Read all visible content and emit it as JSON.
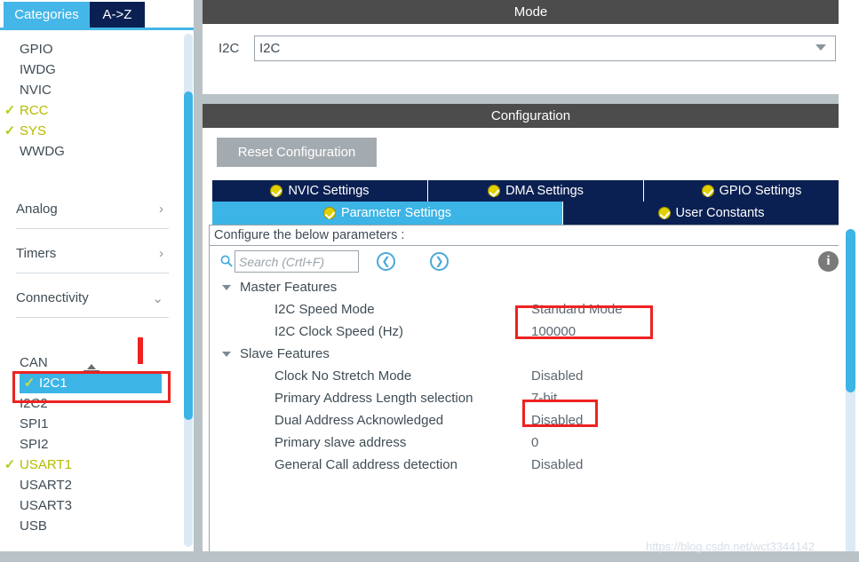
{
  "left_panel": {
    "tabs": [
      {
        "label": "Categories",
        "active": true
      },
      {
        "label": "A->Z",
        "active": false
      }
    ],
    "top_items": [
      {
        "label": "GPIO",
        "enabled": true,
        "checked": false
      },
      {
        "label": "IWDG",
        "enabled": false,
        "checked": false
      },
      {
        "label": "NVIC",
        "enabled": true,
        "checked": false
      },
      {
        "label": "RCC",
        "enabled": true,
        "checked": true
      },
      {
        "label": "SYS",
        "enabled": true,
        "checked": true
      },
      {
        "label": "WWDG",
        "enabled": false,
        "checked": false
      }
    ],
    "groups": [
      {
        "label": "Analog",
        "expanded": false,
        "arrow": "chevron-right-icon"
      },
      {
        "label": "Timers",
        "expanded": false,
        "arrow": "chevron-right-icon"
      },
      {
        "label": "Connectivity",
        "expanded": true,
        "arrow": "chevron-down-icon"
      }
    ],
    "connectivity_items": [
      {
        "label": "CAN",
        "enabled": false,
        "checked": false,
        "selected": false
      },
      {
        "label": "I2C1",
        "enabled": true,
        "checked": true,
        "selected": true
      },
      {
        "label": "I2C2",
        "enabled": false,
        "checked": false,
        "selected": false
      },
      {
        "label": "SPI1",
        "enabled": false,
        "checked": false,
        "selected": false
      },
      {
        "label": "SPI2",
        "enabled": false,
        "checked": false,
        "selected": false
      },
      {
        "label": "USART1",
        "enabled": true,
        "checked": true,
        "selected": false
      },
      {
        "label": "USART2",
        "enabled": false,
        "checked": false,
        "selected": false
      },
      {
        "label": "USART3",
        "enabled": false,
        "checked": false,
        "selected": false
      },
      {
        "label": "USB",
        "enabled": false,
        "checked": false,
        "selected": false
      }
    ]
  },
  "mode": {
    "header": "Mode",
    "field_label": "I2C",
    "selected_value": "I2C",
    "chevron": "chevron-down-icon"
  },
  "configuration": {
    "header": "Configuration",
    "reset_button": "Reset Configuration",
    "tabs_row1": [
      {
        "label": "NVIC Settings",
        "active": false
      },
      {
        "label": "DMA Settings",
        "active": false
      },
      {
        "label": "GPIO Settings",
        "active": false
      }
    ],
    "tabs_row2": [
      {
        "label": "Parameter Settings",
        "active": true
      },
      {
        "label": "User Constants",
        "active": false
      }
    ],
    "caption": "Configure the below parameters :",
    "search": {
      "placeholder": "Search (Crtl+F)",
      "value": "",
      "icon": "search-icon",
      "prev_icon": "chevron-left-circle-icon",
      "next_icon": "chevron-right-circle-icon"
    },
    "info_icon_label": "i",
    "tree": [
      {
        "type": "group",
        "label": "Master Features",
        "expanded": true
      },
      {
        "type": "item",
        "label": "I2C Speed Mode",
        "value": "Standard Mode",
        "highlighted": true
      },
      {
        "type": "item",
        "label": "I2C Clock Speed (Hz)",
        "value": "100000"
      },
      {
        "type": "group",
        "label": "Slave Features",
        "expanded": true
      },
      {
        "type": "item",
        "label": "Clock No Stretch Mode",
        "value": "Disabled"
      },
      {
        "type": "item",
        "label": "Primary Address Length selection",
        "value": "7-bit",
        "highlighted": true
      },
      {
        "type": "item",
        "label": "Dual Address Acknowledged",
        "value": "Disabled"
      },
      {
        "type": "item",
        "label": "Primary slave address",
        "value": "0"
      },
      {
        "type": "item",
        "label": "General Call address detection",
        "value": "Disabled"
      }
    ]
  },
  "annotations": {
    "color": "#ee2222",
    "boxes": [
      "i2c-speed-mode-value",
      "primary-address-length-value",
      "sidebar-i2c1-item"
    ]
  },
  "watermark": "https://blog.csdn.net/wct3344142",
  "colors": {
    "accent_blue": "#3cb4e5",
    "tab_navy": "#0b2052",
    "panel_header_gray": "#4c4c4c",
    "enabled_green": "#b5bb00",
    "annotation_red": "#ee2222"
  }
}
